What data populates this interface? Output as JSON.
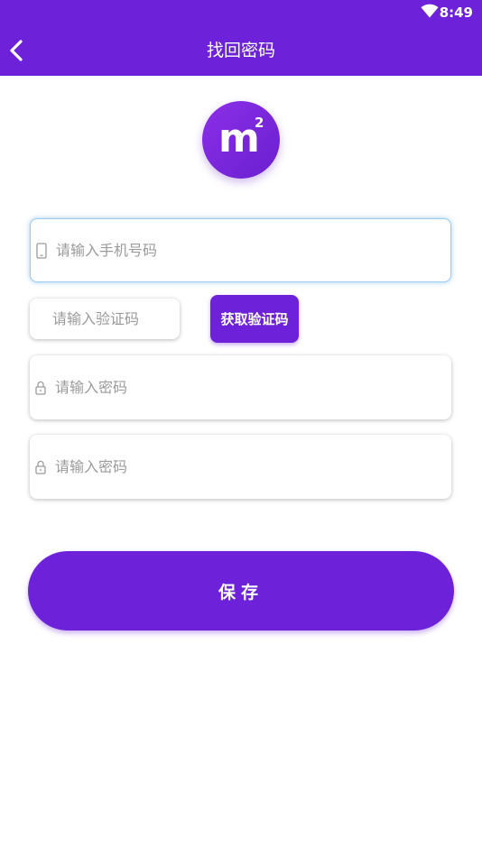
{
  "status_bar": {
    "time": "8:49",
    "wifi_icon": "wifi-icon"
  },
  "header": {
    "title": "找回密码",
    "back_icon": "chevron-left-icon",
    "background_color": "#6d22d9"
  },
  "logo": {
    "letter": "m",
    "superscript": "2"
  },
  "form": {
    "phone": {
      "placeholder": "请输入手机号码",
      "value": "",
      "icon": "phone-icon"
    },
    "code": {
      "placeholder": "请输入验证码",
      "value": ""
    },
    "get_code_label": "获取验证码",
    "password": {
      "placeholder": "请输入密码",
      "value": "",
      "icon": "lock-icon"
    },
    "confirm_password": {
      "placeholder": "请输入密码",
      "value": "",
      "icon": "lock-icon"
    },
    "save_label": "保存"
  },
  "colors": {
    "accent": "#6d22d9",
    "placeholder": "#9a9a9a"
  }
}
